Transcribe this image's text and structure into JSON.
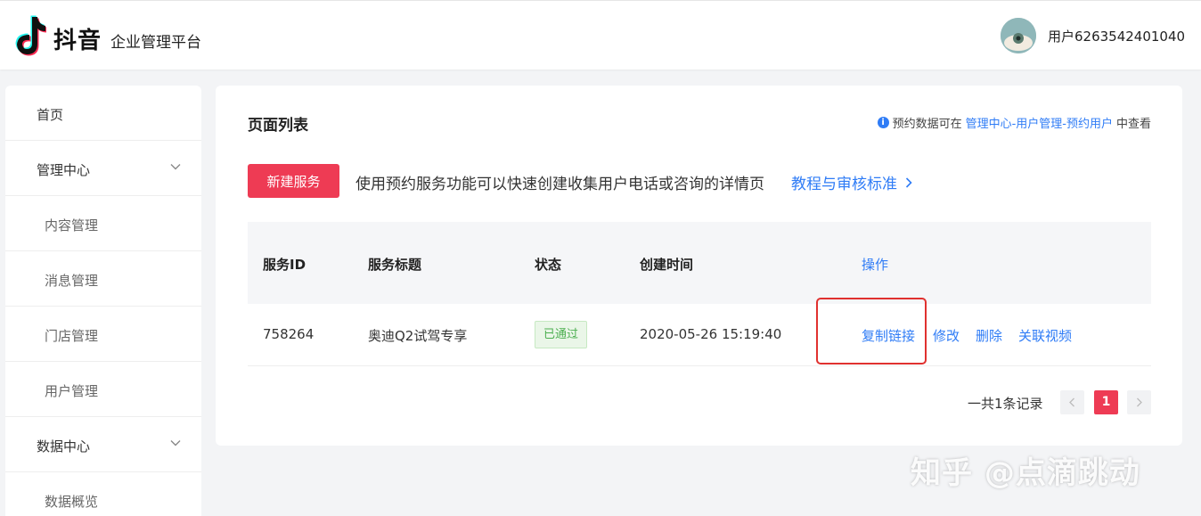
{
  "header": {
    "brand": "抖音",
    "brand_sub": "企业管理平台",
    "username": "用户6263542401040"
  },
  "sidebar": {
    "items": [
      {
        "label": "首页",
        "level": "top"
      },
      {
        "label": "管理中心",
        "level": "top",
        "expandable": true
      },
      {
        "label": "内容管理",
        "level": "sub"
      },
      {
        "label": "消息管理",
        "level": "sub"
      },
      {
        "label": "门店管理",
        "level": "sub"
      },
      {
        "label": "用户管理",
        "level": "sub"
      },
      {
        "label": "数据中心",
        "level": "top",
        "expandable": true
      },
      {
        "label": "数据概览",
        "level": "sub"
      }
    ]
  },
  "main": {
    "title": "页面列表",
    "notice_prefix": "预约数据可在",
    "notice_link": "管理中心-用户管理-预约用户",
    "notice_suffix": "中查看",
    "new_button": "新建服务",
    "description": "使用预约服务功能可以快速创建收集用户电话或咨询的详情页",
    "guide_link": "教程与审核标准",
    "table": {
      "headers": [
        "服务ID",
        "服务标题",
        "状态",
        "创建时间",
        "操作"
      ],
      "rows": [
        {
          "id": "758264",
          "title": "奥迪Q2试驾专享",
          "status": "已通过",
          "created": "2020-05-26 15:19:40",
          "actions": [
            "复制链接",
            "修改",
            "删除",
            "关联视频"
          ]
        }
      ]
    },
    "pagination": {
      "total": "一共1条记录",
      "current": "1"
    }
  },
  "watermark": "知乎 @点滴跳动",
  "colors": {
    "accent": "#ee3b54",
    "link": "#2f7cf6",
    "status_green": "#4caf50",
    "highlight": "#e0312f"
  }
}
